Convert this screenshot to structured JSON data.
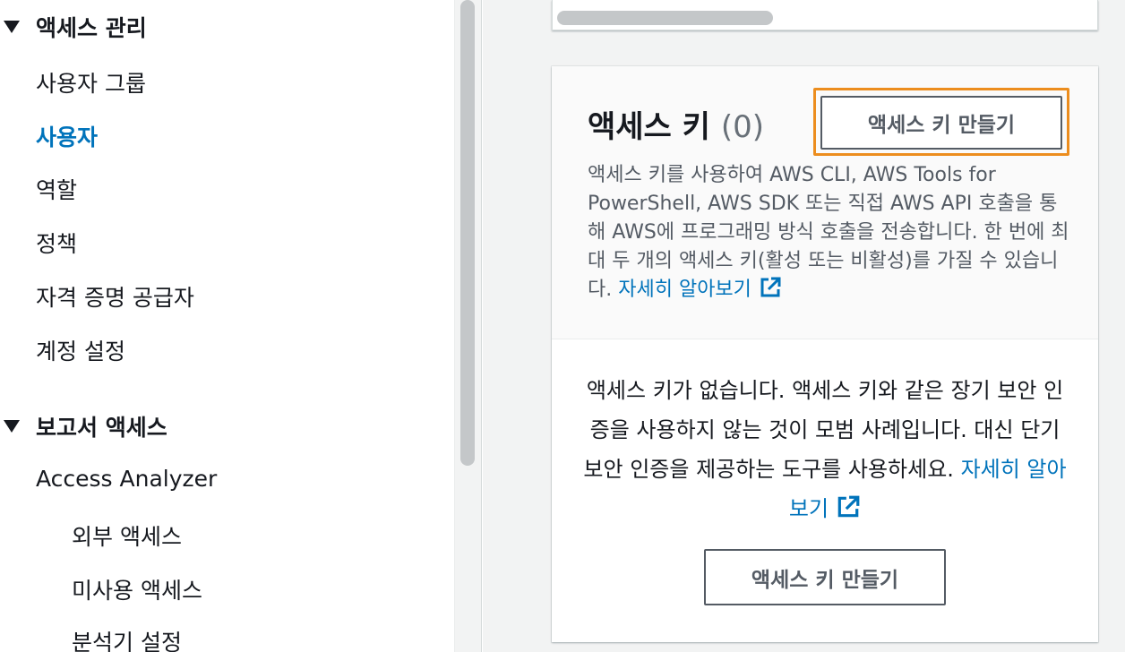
{
  "sidebar": {
    "access_management": {
      "header": "액세스 관리",
      "items": [
        "사용자 그룹",
        "사용자",
        "역할",
        "정책",
        "자격 증명 공급자",
        "계정 설정"
      ],
      "active_item": "사용자"
    },
    "access_reports": {
      "header": "보고서 액세스",
      "items": [
        "Access Analyzer"
      ],
      "subitems": [
        "외부 액세스",
        "미사용 액세스",
        "분석기 설정"
      ]
    }
  },
  "access_keys": {
    "title": "액세스 키",
    "count": "(0)",
    "create_button": "액세스 키 만들기",
    "description": "액세스 키를 사용하여 AWS CLI, AWS Tools for PowerShell, AWS SDK 또는 직접 AWS API 호출을 통해 AWS에 프로그래밍 방식 호출을 전송합니다. 한 번에 최대 두 개의 액세스 키(활성 또는 비활성)를 가질 수 있습니다.",
    "learn_more": "자세히 알아보기",
    "empty_text": "액세스 키가 없습니다. 액세스 키와 같은 장기 보안 인증을 사용하지 않는 것이 모범 사례입니다. 대신 단기 보안 인증을 제공하는 도구를 사용하세요.",
    "empty_learn_more": "자세히 알아보기",
    "empty_button": "액세스 키 만들기"
  },
  "colors": {
    "link": "#0073bb",
    "focus_outline": "#ec8d1e",
    "button_border": "#545b64"
  },
  "icons": [
    "caret-down-icon",
    "external-link-icon"
  ]
}
